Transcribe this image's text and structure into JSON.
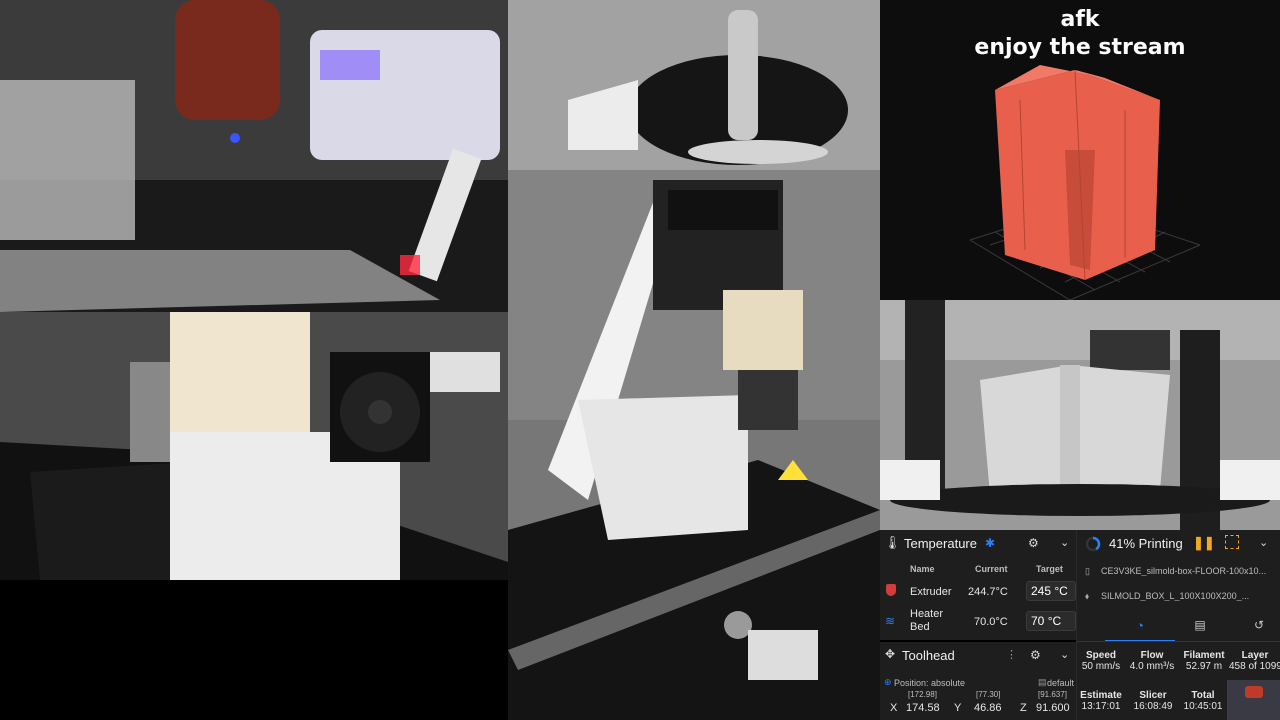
{
  "overlay": {
    "line1": "afk",
    "line2": "enjoy the stream"
  },
  "temperature_panel": {
    "title": "Temperature",
    "columns": {
      "name": "Name",
      "current": "Current",
      "target": "Target"
    },
    "heaters": [
      {
        "name": "Extruder",
        "current": "244.7°C",
        "target": "245",
        "unit": "°C"
      },
      {
        "name_line1": "Heater",
        "name_line2": "Bed",
        "current": "70.0°C",
        "target": "70",
        "unit": "°C"
      }
    ]
  },
  "toolhead_panel": {
    "title": "Toolhead",
    "position_mode": "Position: absolute",
    "profile": "default",
    "axes": [
      {
        "label": "X",
        "raw": "[172.98]",
        "value": "174.58"
      },
      {
        "label": "Y",
        "raw": "[77.30]",
        "value": "46.86"
      },
      {
        "label": "Z",
        "raw": "[91.637]",
        "value": "91.600"
      }
    ]
  },
  "print_panel": {
    "status": "41% Printing",
    "progress": 0.41,
    "file1": "CE3V3KE_silmold-box-FLOOR-100x10...",
    "file2": "SILMOLD_BOX_L_100X100X200_...",
    "stats": [
      {
        "label": "Speed",
        "value": "50 mm/s"
      },
      {
        "label": "Flow",
        "value": "4.0 mm³/s"
      },
      {
        "label": "Filament",
        "value": "52.97 m"
      },
      {
        "label": "Layer",
        "value": "458 of 1099"
      }
    ],
    "times": [
      {
        "label": "Estimate",
        "value": "13:17:01"
      },
      {
        "label": "Slicer",
        "value": "16:08:49"
      },
      {
        "label": "Total",
        "value": "10:45:01"
      }
    ]
  },
  "colors": {
    "accent": "#2d7ff9",
    "pause": "#f5a623",
    "model": "#e8604c",
    "panel": "#1e1e1e"
  }
}
